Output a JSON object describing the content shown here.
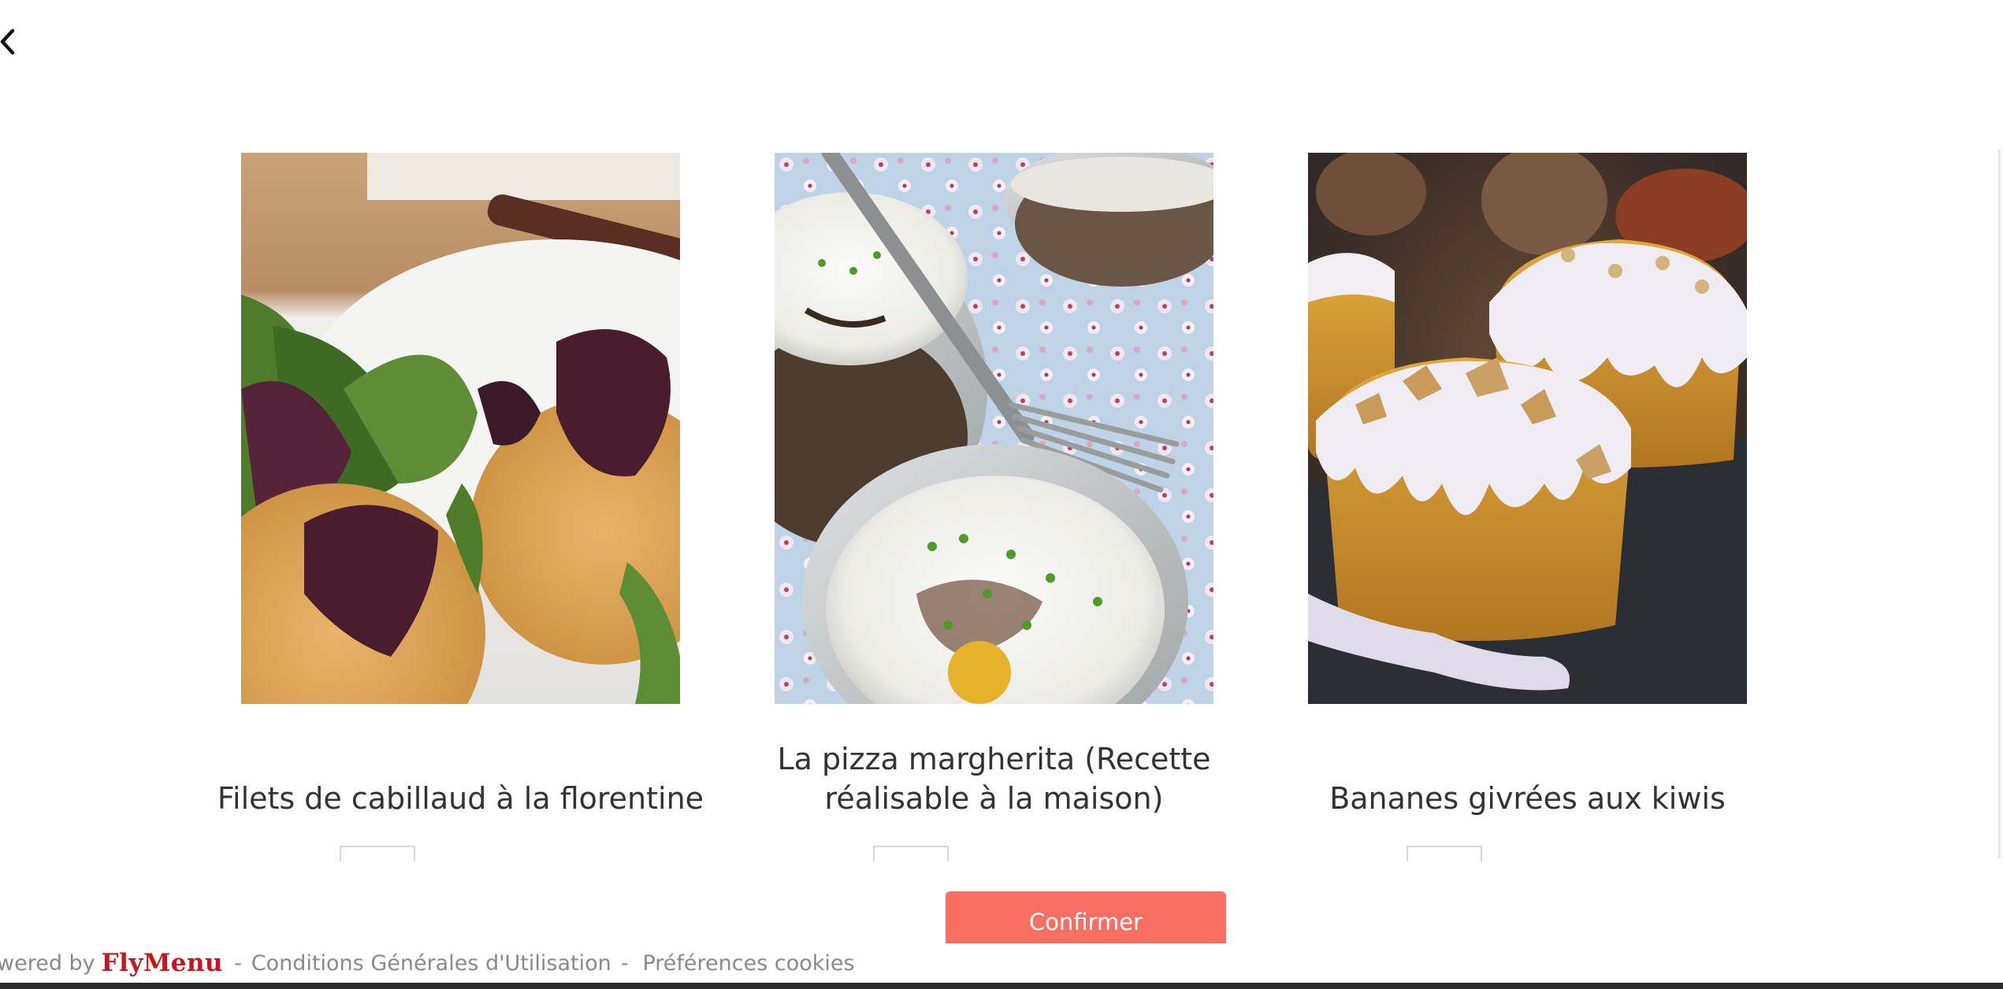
{
  "nav": {
    "back_icon": "chevron-left-icon"
  },
  "recipes": [
    {
      "title": "Filets de cabillaud à la florentine",
      "image": "cod-fillets-salad-photo"
    },
    {
      "title": "La pizza margherita (Recette réalisable à la maison)",
      "image": "eggs-in-jars-photo"
    },
    {
      "title": "Bananes givrées aux kiwis",
      "image": "glazed-muffins-photo"
    }
  ],
  "actions": {
    "confirm_label": "Confirmer",
    "confirm_color": "#f86f61"
  },
  "footer": {
    "powered_by": "wered by",
    "brand": "FlyMenu",
    "brand_color": "#c8141b",
    "separator": "-",
    "terms_link": "Conditions Générales d'Utilisation",
    "cookies_link": "Préférences cookies"
  }
}
